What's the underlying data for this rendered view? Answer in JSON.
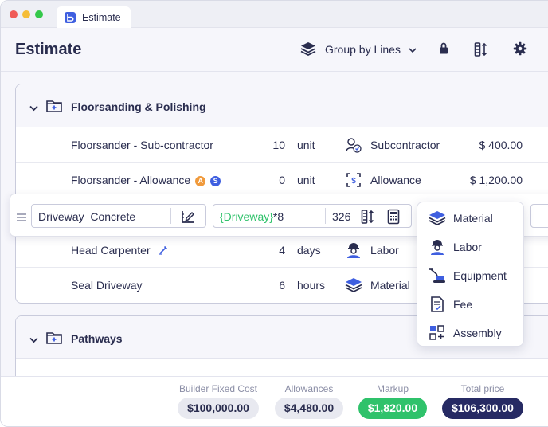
{
  "window": {
    "tab_title": "Estimate",
    "traffic_lights": {
      "red": "#f05b57",
      "yellow": "#f5bd38",
      "green": "#34c84a"
    }
  },
  "header": {
    "title": "Estimate",
    "group_by_label": "Group by Lines",
    "icons": [
      "layers-icon",
      "lock-icon",
      "sort-columns-icon",
      "gear-icon"
    ]
  },
  "sections": [
    {
      "title": "Floorsanding & Polishing",
      "rows": [
        {
          "name": "Floorsander - Sub-contractor",
          "qty": "10",
          "unit": "unit",
          "type": "Subcontractor",
          "type_icon": "subcontractor-icon",
          "price": "$ 400.00"
        },
        {
          "name": "Floorsander - Allowance",
          "badges": [
            "A",
            "S"
          ],
          "qty": "0",
          "unit": "unit",
          "type": "Allowance",
          "type_icon": "allowance-icon",
          "price": "$ 1,200.00"
        },
        {
          "name": "Head Carpenter",
          "qty": "4",
          "unit": "days",
          "type": "Labor",
          "type_icon": "labor-icon",
          "price": ""
        },
        {
          "name": "Seal Driveway",
          "qty": "6",
          "unit": "hours",
          "type": "Material",
          "type_icon": "material-icon",
          "price": ""
        }
      ]
    },
    {
      "title": "Pathways",
      "rows": []
    }
  ],
  "edit_row": {
    "name_value": "Driveway  Concrete",
    "formula_variable": "{Driveway}",
    "formula_rest": "*8",
    "formula_result": "326"
  },
  "type_dropdown": {
    "items": [
      {
        "label": "Material",
        "icon": "material-icon"
      },
      {
        "label": "Labor",
        "icon": "labor-icon"
      },
      {
        "label": "Equipment",
        "icon": "equipment-icon"
      },
      {
        "label": "Fee",
        "icon": "fee-icon"
      },
      {
        "label": "Assembly",
        "icon": "assembly-icon"
      }
    ]
  },
  "totals": [
    {
      "label": "Builder Fixed Cost",
      "value": "$100,000.00",
      "style": "gray"
    },
    {
      "label": "Allowances",
      "value": "$4,480.00",
      "style": "gray"
    },
    {
      "label": "Markup",
      "value": "$1,820.00",
      "style": "green"
    },
    {
      "label": "Total price",
      "value": "$106,300.00",
      "style": "navy"
    }
  ],
  "colors": {
    "accent_blue": "#3f5fe0",
    "text_dark": "#2a2d4f",
    "green": "#2fc26b",
    "navy": "#262a63",
    "badge_orange": "#f09a3c"
  }
}
